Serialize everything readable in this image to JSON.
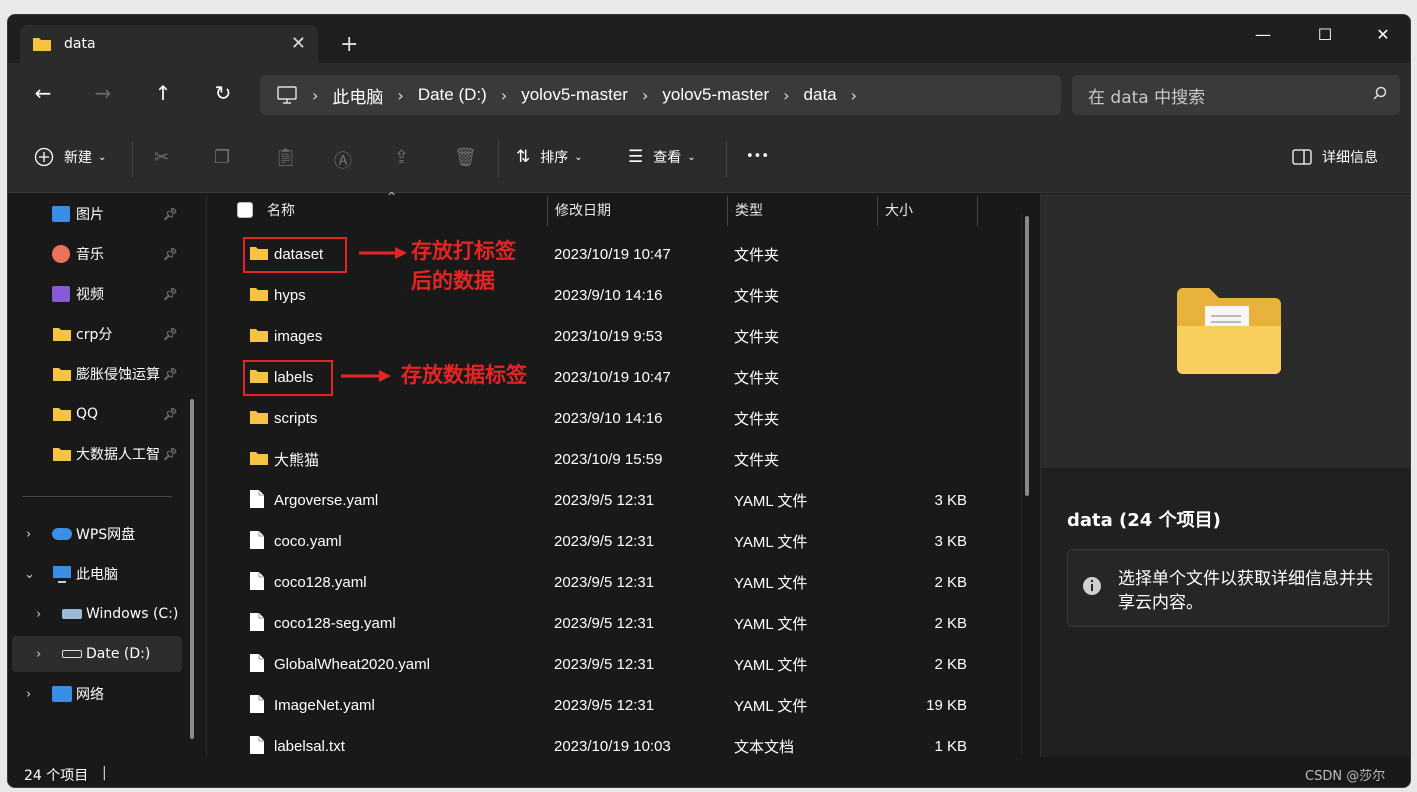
{
  "window": {
    "tab_title": "data",
    "controls": {
      "minimize": "—",
      "maximize": "☐",
      "close": "✕"
    }
  },
  "address": {
    "crumbs": [
      "此电脑",
      "Date (D:)",
      "yolov5-master",
      "yolov5-master",
      "data"
    ],
    "search_placeholder": "在 data 中搜索"
  },
  "toolbar": {
    "new_label": "新建",
    "sort_label": "排序",
    "view_label": "查看",
    "more_label": "•••",
    "details_label": "详细信息"
  },
  "sidebar": {
    "pinned": [
      {
        "label": "图片",
        "icon": "pictures-icon"
      },
      {
        "label": "音乐",
        "icon": "music-icon"
      },
      {
        "label": "视频",
        "icon": "videos-icon"
      },
      {
        "label": "crp分",
        "icon": "folder-icon"
      },
      {
        "label": "膨胀侵蚀运算",
        "icon": "folder-icon"
      },
      {
        "label": "QQ",
        "icon": "folder-icon"
      },
      {
        "label": "大数据人工智",
        "icon": "folder-icon"
      }
    ],
    "tree": [
      {
        "label": "WPS网盘",
        "icon": "cloud-icon"
      },
      {
        "label": "此电脑",
        "icon": "computer-icon"
      },
      {
        "label": "Windows (C:)",
        "icon": "drive-icon"
      },
      {
        "label": "Date (D:)",
        "icon": "drive-icon"
      },
      {
        "label": "网络",
        "icon": "network-icon"
      }
    ]
  },
  "columns": {
    "name": "名称",
    "date": "修改日期",
    "type": "类型",
    "size": "大小"
  },
  "files": [
    {
      "name": "dataset",
      "date": "2023/10/19 10:47",
      "type": "文件夹",
      "size": "",
      "kind": "folder"
    },
    {
      "name": "hyps",
      "date": "2023/9/10 14:16",
      "type": "文件夹",
      "size": "",
      "kind": "folder"
    },
    {
      "name": "images",
      "date": "2023/10/19 9:53",
      "type": "文件夹",
      "size": "",
      "kind": "folder"
    },
    {
      "name": "labels",
      "date": "2023/10/19 10:47",
      "type": "文件夹",
      "size": "",
      "kind": "folder"
    },
    {
      "name": "scripts",
      "date": "2023/9/10 14:16",
      "type": "文件夹",
      "size": "",
      "kind": "folder"
    },
    {
      "name": "大熊猫",
      "date": "2023/10/9 15:59",
      "type": "文件夹",
      "size": "",
      "kind": "folder"
    },
    {
      "name": "Argoverse.yaml",
      "date": "2023/9/5 12:31",
      "type": "YAML 文件",
      "size": "3 KB",
      "kind": "file"
    },
    {
      "name": "coco.yaml",
      "date": "2023/9/5 12:31",
      "type": "YAML 文件",
      "size": "3 KB",
      "kind": "file"
    },
    {
      "name": "coco128.yaml",
      "date": "2023/9/5 12:31",
      "type": "YAML 文件",
      "size": "2 KB",
      "kind": "file"
    },
    {
      "name": "coco128-seg.yaml",
      "date": "2023/9/5 12:31",
      "type": "YAML 文件",
      "size": "2 KB",
      "kind": "file"
    },
    {
      "name": "GlobalWheat2020.yaml",
      "date": "2023/9/5 12:31",
      "type": "YAML 文件",
      "size": "2 KB",
      "kind": "file"
    },
    {
      "name": "ImageNet.yaml",
      "date": "2023/9/5 12:31",
      "type": "YAML 文件",
      "size": "19 KB",
      "kind": "file"
    },
    {
      "name": "labelsal.txt",
      "date": "2023/10/19 10:03",
      "type": "文本文档",
      "size": "1 KB",
      "kind": "file"
    }
  ],
  "annotations": {
    "dataset_note": "存放打标签\n后的数据",
    "labels_note": "存放数据标签"
  },
  "details": {
    "title": "data (24 个项目)",
    "info": "选择单个文件以获取详细信息并共享云内容。"
  },
  "status": {
    "count": "24 个项目",
    "sep": "|",
    "watermark": "CSDN @莎尔"
  },
  "colors": {
    "folder": "#f5c242",
    "annotation": "#e52424",
    "accent": "#4cc2ff"
  }
}
